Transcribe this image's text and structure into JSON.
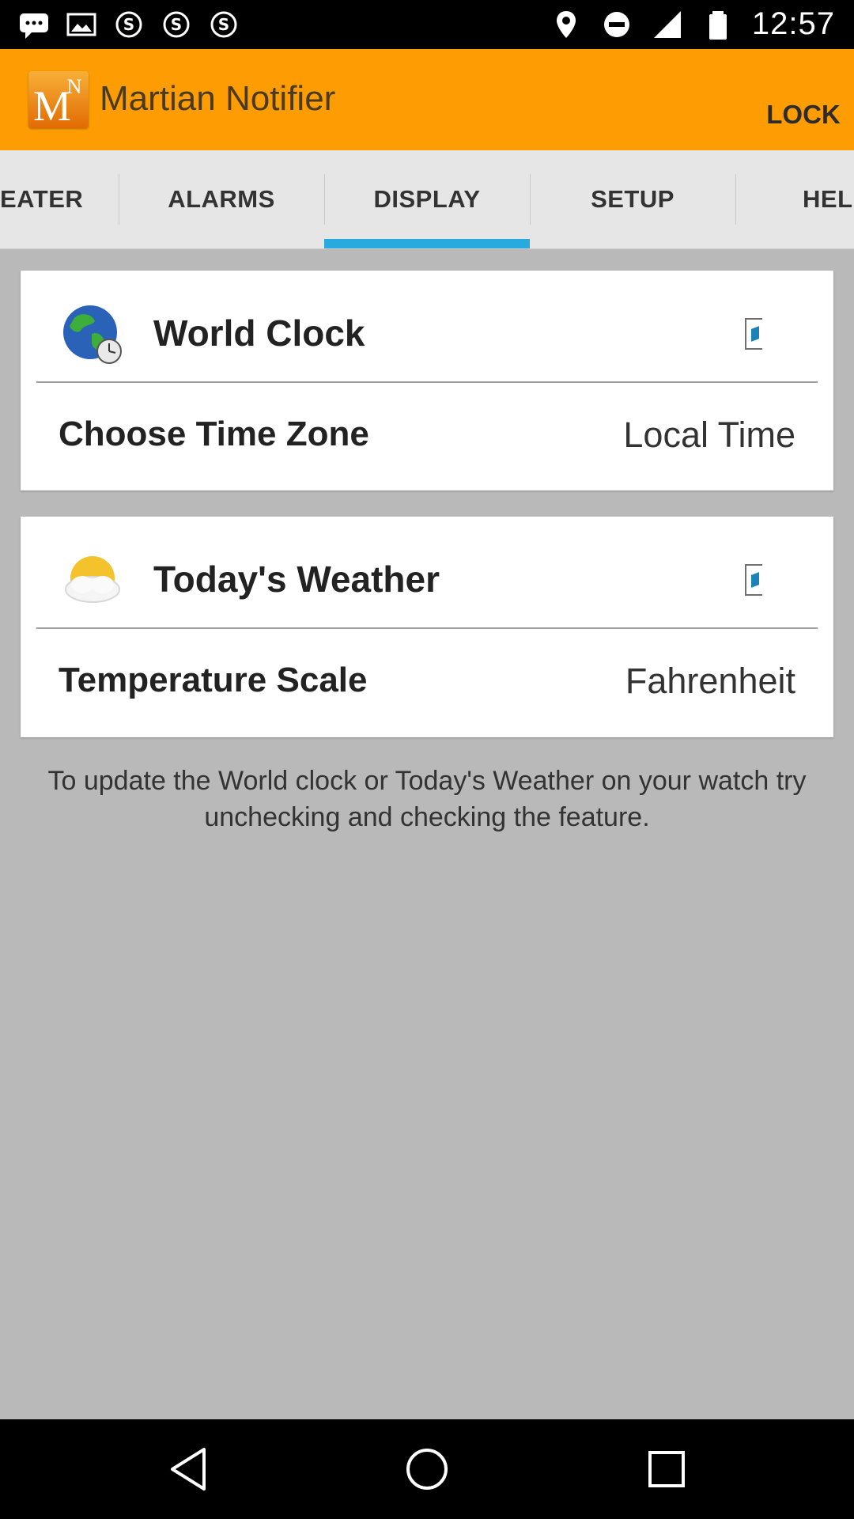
{
  "status_bar": {
    "time": "12:57",
    "left_icons": [
      "chat-icon",
      "image-icon",
      "skype-icon",
      "skype-icon",
      "skype-icon"
    ],
    "right_icons": [
      "location-icon",
      "dnd-icon",
      "signal-icon",
      "battery-icon"
    ]
  },
  "header": {
    "title": "Martian Notifier",
    "logo_letters": "M N",
    "lock_label": "LOCK"
  },
  "tabs": [
    {
      "label": "EATER"
    },
    {
      "label": "ALARMS"
    },
    {
      "label": "DISPLAY"
    },
    {
      "label": "SETUP"
    },
    {
      "label": "HEL"
    }
  ],
  "active_tab": "DISPLAY",
  "world_clock": {
    "title": "World Clock",
    "row_label": "Choose Time Zone",
    "row_value": "Local Time"
  },
  "weather": {
    "title": "Today's Weather",
    "row_label": "Temperature Scale",
    "row_value": "Fahrenheit"
  },
  "info": "To update the World clock or Today's Weather on your watch try unchecking and checking the feature.",
  "colors": {
    "header": "#fd9c03",
    "tab_indicator": "#29aadf",
    "background": "#b9b9b9"
  }
}
